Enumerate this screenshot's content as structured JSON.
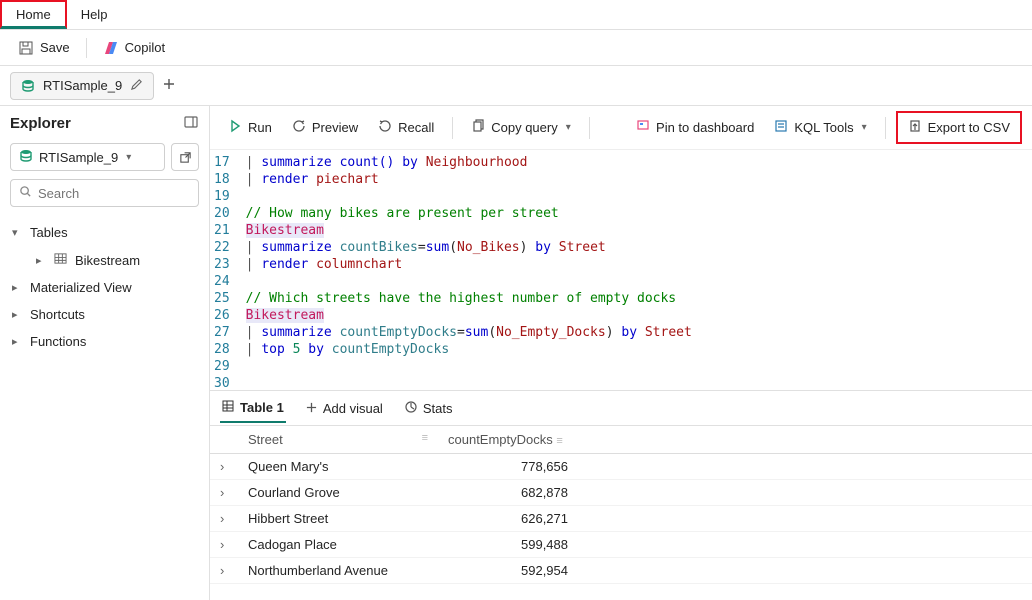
{
  "menu": {
    "home": "Home",
    "help": "Help"
  },
  "toolbar": {
    "save": "Save",
    "copilot": "Copilot"
  },
  "fileTab": {
    "name": "RTISample_9"
  },
  "explorer": {
    "title": "Explorer",
    "dbName": "RTISample_9",
    "searchPlaceholder": "Search",
    "tables": "Tables",
    "bikestream": "Bikestream",
    "matView": "Materialized View",
    "shortcuts": "Shortcuts",
    "functions": "Functions"
  },
  "actions": {
    "run": "Run",
    "preview": "Preview",
    "recall": "Recall",
    "copy": "Copy query",
    "pin": "Pin to dashboard",
    "kql": "KQL Tools",
    "export": "Export to CSV"
  },
  "editor": {
    "startLine": 17,
    "lines": [
      [
        {
          "t": "| ",
          "c": "tok-pipe"
        },
        {
          "t": "summarize ",
          "c": "tok-kw"
        },
        {
          "t": "count()",
          "c": "tok-fn"
        },
        {
          "t": " by ",
          "c": "tok-kw"
        },
        {
          "t": "Neighbourhood",
          "c": "tok-id"
        }
      ],
      [
        {
          "t": "| ",
          "c": "tok-pipe"
        },
        {
          "t": "render ",
          "c": "tok-kw"
        },
        {
          "t": "piechart",
          "c": "tok-id"
        }
      ],
      [],
      [
        {
          "t": "// How many bikes are present per street",
          "c": "tok-comment"
        }
      ],
      [
        {
          "t": "Bikestream",
          "c": "tok-tab tok-hl"
        }
      ],
      [
        {
          "t": "| ",
          "c": "tok-pipe"
        },
        {
          "t": "summarize ",
          "c": "tok-kw"
        },
        {
          "t": "countBikes",
          "c": "tok-field"
        },
        {
          "t": "=",
          "c": ""
        },
        {
          "t": "sum",
          "c": "tok-fn"
        },
        {
          "t": "(",
          "c": ""
        },
        {
          "t": "No_Bikes",
          "c": "tok-id"
        },
        {
          "t": ")",
          "c": ""
        },
        {
          "t": " by ",
          "c": "tok-kw"
        },
        {
          "t": "Street",
          "c": "tok-id"
        }
      ],
      [
        {
          "t": "| ",
          "c": "tok-pipe"
        },
        {
          "t": "render ",
          "c": "tok-kw"
        },
        {
          "t": "columnchart",
          "c": "tok-id"
        }
      ],
      [],
      [
        {
          "t": "// Which streets have the highest number of empty docks",
          "c": "tok-comment"
        }
      ],
      [
        {
          "t": "Bikestream",
          "c": "tok-tab tok-hl"
        }
      ],
      [
        {
          "t": "| ",
          "c": "tok-pipe"
        },
        {
          "t": "summarize ",
          "c": "tok-kw"
        },
        {
          "t": "countEmptyDocks",
          "c": "tok-field"
        },
        {
          "t": "=",
          "c": ""
        },
        {
          "t": "sum",
          "c": "tok-fn"
        },
        {
          "t": "(",
          "c": ""
        },
        {
          "t": "No_Empty_Docks",
          "c": "tok-id"
        },
        {
          "t": ")",
          "c": ""
        },
        {
          "t": " by ",
          "c": "tok-kw"
        },
        {
          "t": "Street",
          "c": "tok-id"
        }
      ],
      [
        {
          "t": "| ",
          "c": "tok-pipe"
        },
        {
          "t": "top ",
          "c": "tok-kw"
        },
        {
          "t": "5",
          "c": "tok-num"
        },
        {
          "t": " by ",
          "c": "tok-kw"
        },
        {
          "t": "countEmptyDocks",
          "c": "tok-field"
        }
      ],
      [],
      []
    ]
  },
  "resultsTabs": {
    "table1": "Table 1",
    "addVisual": "Add visual",
    "stats": "Stats"
  },
  "resultsHeaders": {
    "street": "Street",
    "count": "countEmptyDocks"
  },
  "resultsRows": [
    {
      "street": "Queen Mary's",
      "count": "778,656"
    },
    {
      "street": "Courland Grove",
      "count": "682,878"
    },
    {
      "street": "Hibbert Street",
      "count": "626,271"
    },
    {
      "street": "Cadogan Place",
      "count": "599,488"
    },
    {
      "street": "Northumberland Avenue",
      "count": "592,954"
    }
  ]
}
